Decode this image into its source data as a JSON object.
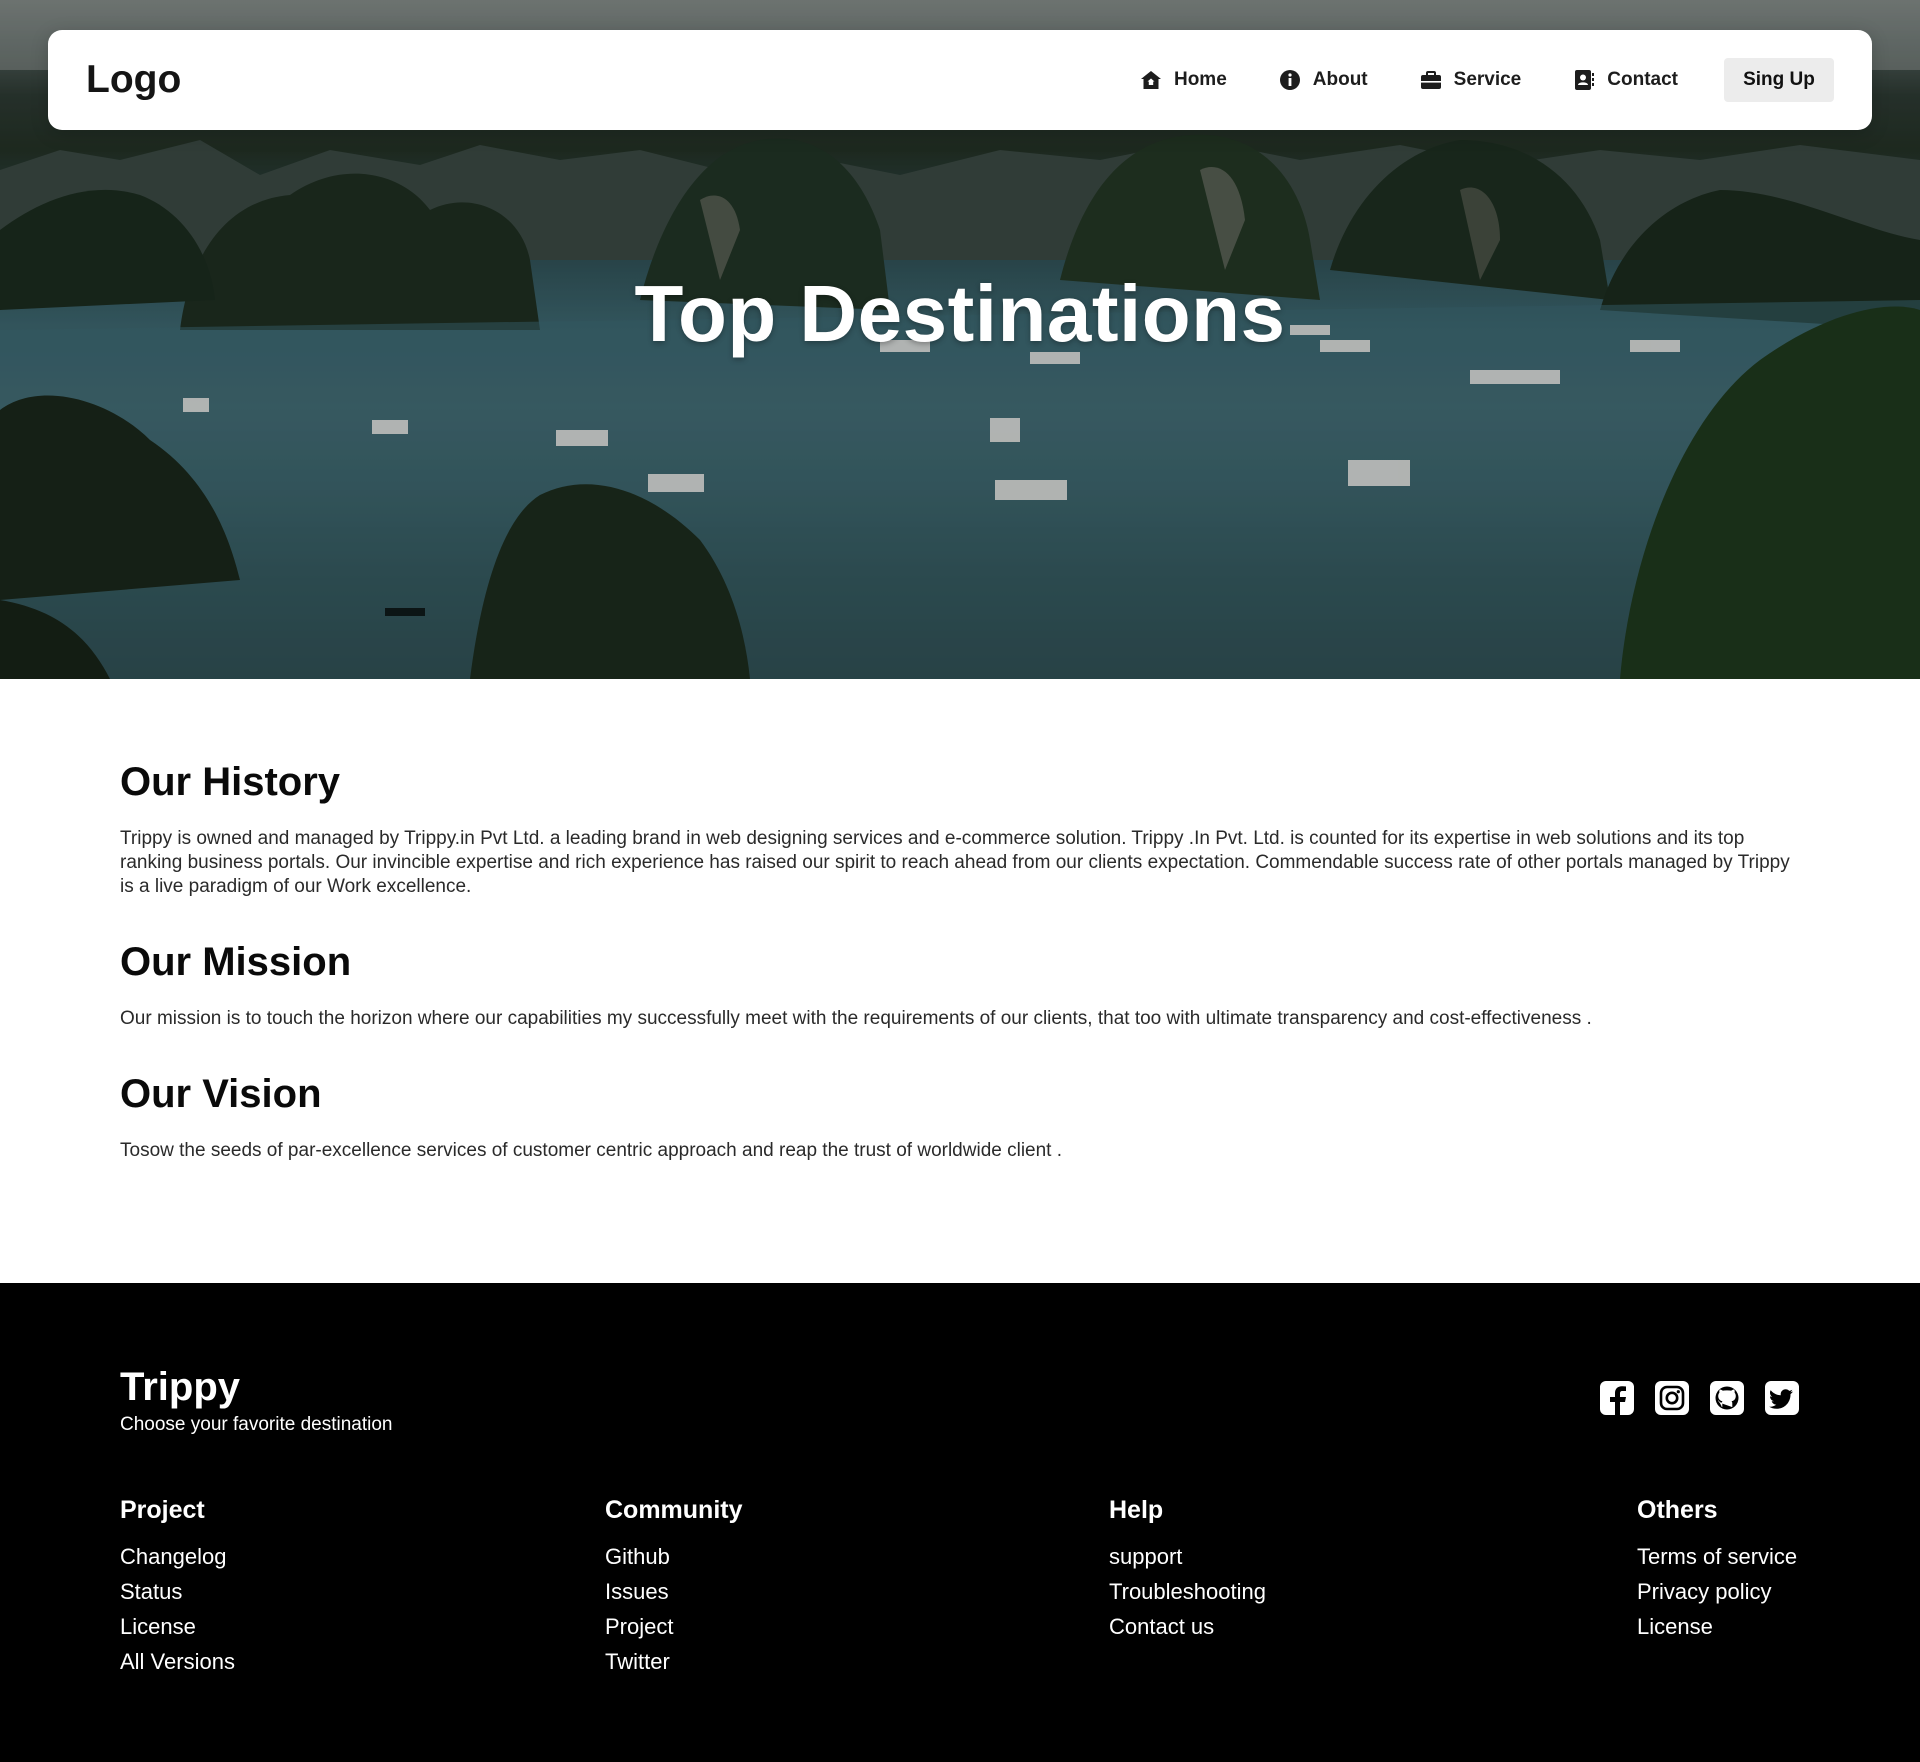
{
  "navbar": {
    "logo": "Logo",
    "links": [
      {
        "label": "Home",
        "icon": "home-icon"
      },
      {
        "label": "About",
        "icon": "info-icon"
      },
      {
        "label": "Service",
        "icon": "briefcase-icon"
      },
      {
        "label": "Contact",
        "icon": "contact-card-icon"
      }
    ],
    "signup_label": "Sing Up"
  },
  "hero": {
    "title": "Top Destinations"
  },
  "sections": {
    "history": {
      "heading": "Our History",
      "body": "Trippy is owned and managed by Trippy.in Pvt Ltd. a leading brand in web designing services and e-commerce solution. Trippy .In Pvt. Ltd. is counted for its expertise in web solutions and its top ranking business portals. Our invincible expertise and rich experience has raised our spirit to reach ahead from our clients expectation. Commendable success rate of other portals managed by Trippy is a live paradigm of our Work excellence."
    },
    "mission": {
      "heading": "Our Mission",
      "body": "Our mission is to touch the horizon where our capabilities my successfully meet with the requirements of our clients, that too with ultimate transparency and cost-effectiveness ."
    },
    "vision": {
      "heading": "Our Vision",
      "body": "Tosow the seeds of par-excellence services of customer centric approach and reap the trust of worldwide client ."
    }
  },
  "footer": {
    "brand": "Trippy",
    "tagline": "Choose your favorite destination",
    "socials": [
      "facebook-icon",
      "instagram-icon",
      "github-icon",
      "twitter-icon"
    ],
    "columns": [
      {
        "title": "Project",
        "links": [
          "Changelog",
          "Status",
          "License",
          "All Versions"
        ]
      },
      {
        "title": "Community",
        "links": [
          "Github",
          "Issues",
          "Project",
          "Twitter"
        ]
      },
      {
        "title": "Help",
        "links": [
          "support",
          "Troubleshooting",
          "Contact us"
        ]
      },
      {
        "title": "Others",
        "links": [
          "Terms of service",
          "Privacy policy",
          "License"
        ]
      }
    ]
  }
}
